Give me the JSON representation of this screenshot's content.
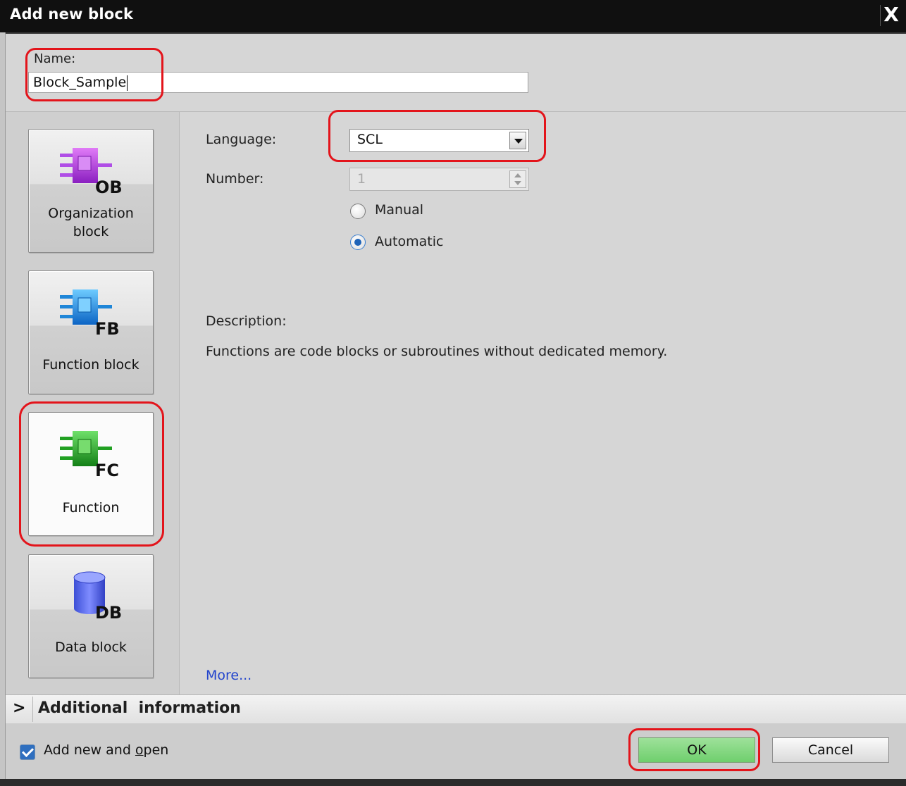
{
  "dialog": {
    "title": "Add new block",
    "close_label": "X"
  },
  "name": {
    "label": "Name:",
    "value": "Block_Sample"
  },
  "block_types": [
    {
      "label": "Organization block",
      "icon": "ob-block-icon",
      "badge": "OB",
      "color": "#a83be0",
      "selected": false
    },
    {
      "label": "Function block",
      "icon": "fb-block-icon",
      "badge": "FB",
      "color": "#1c8fe0",
      "selected": false
    },
    {
      "label": "Function",
      "icon": "fc-block-icon",
      "badge": "FC",
      "color": "#1fa51f",
      "selected": true
    },
    {
      "label": "Data block",
      "icon": "db-block-icon",
      "badge": "DB",
      "color": "#4b5fe8",
      "selected": false
    }
  ],
  "settings": {
    "language_label": "Language:",
    "language_value": "SCL",
    "number_label": "Number:",
    "number_value": "1",
    "radio_manual": "Manual",
    "radio_automatic": "Automatic",
    "selected_radio": "Automatic",
    "description_label": "Description:",
    "description_text": "Functions are code blocks or subroutines without dedicated memory.",
    "more_link": "More..."
  },
  "additional": {
    "chevron": ">",
    "label": "Additional  information"
  },
  "footer": {
    "checkbox_label_pre": "Add new and ",
    "checkbox_label_u": "o",
    "checkbox_label_post": "pen",
    "checkbox_checked": true,
    "ok_label": "OK",
    "cancel_label": "Cancel"
  },
  "colors": {
    "highlight": "#e3141b",
    "ok_button": "#7fd67c",
    "link": "#2244cc"
  }
}
